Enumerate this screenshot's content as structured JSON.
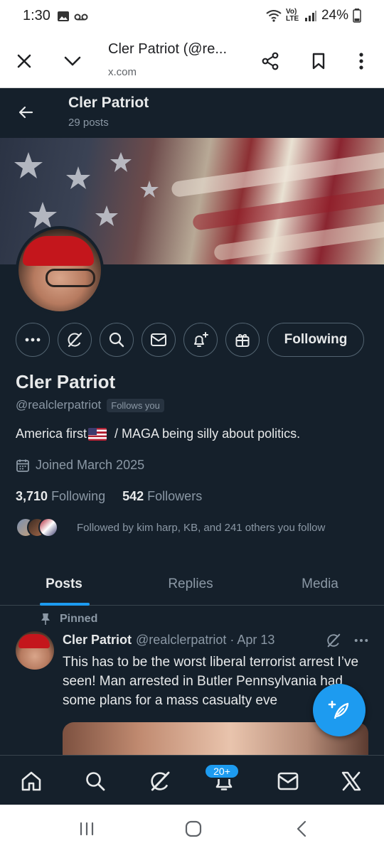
{
  "status_bar": {
    "time": "1:30",
    "battery": "24%",
    "network": "Vo) LTE"
  },
  "browser": {
    "title": "Cler Patriot (@re...",
    "url": "x.com"
  },
  "header": {
    "name": "Cler Patriot",
    "posts_count": "29 posts"
  },
  "profile": {
    "display_name": "Cler Patriot",
    "handle": "@realclerpatriot",
    "follows_you": "Follows you",
    "bio_before_flag": "America first",
    "bio_after_flag": " / MAGA being silly about politics.",
    "joined": "Joined March 2025",
    "following_count": "3,710",
    "following_label": "Following",
    "followers_count": "542",
    "followers_label": "Followers",
    "followed_by": "Followed by kim harp, KB, and 241 others you follow",
    "following_button": "Following"
  },
  "tabs": [
    {
      "label": "Posts",
      "active": true
    },
    {
      "label": "Replies",
      "active": false
    },
    {
      "label": "Media",
      "active": false
    }
  ],
  "post": {
    "pinned_label": "Pinned",
    "author": "Cler Patriot",
    "meta": "@realclerpatriot · Apr 13",
    "text": "This has to be the worst liberal terrorist arrest I’ve seen! Man arrested in Butler Pennsylvania had some plans for a mass casualty eve"
  },
  "bottom_nav": {
    "notifications_badge": "20+"
  },
  "colors": {
    "background": "#15202b",
    "accent": "#1d9bf0",
    "muted_text": "#8b98a5",
    "border": "#536471"
  }
}
